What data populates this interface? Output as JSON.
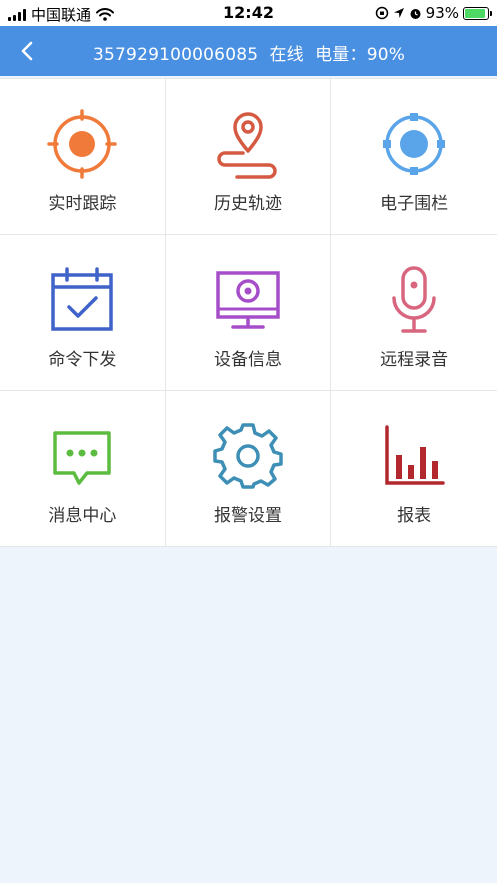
{
  "status_bar": {
    "carrier": "中国联通",
    "time": "12:42",
    "battery_percent": "93%",
    "battery_level": 0.93
  },
  "header": {
    "device_id": "357929100006085",
    "online_status": "在线",
    "battery_text": "电量：90%"
  },
  "menu": [
    {
      "label": "实时跟踪",
      "icon": "crosshair-target-icon",
      "color": "#f07a3a"
    },
    {
      "label": "历史轨迹",
      "icon": "map-pin-route-icon",
      "color": "#d45a42"
    },
    {
      "label": "电子围栏",
      "icon": "geofence-icon",
      "color": "#5aa4ea"
    },
    {
      "label": "命令下发",
      "icon": "calendar-check-icon",
      "color": "#3f63c9"
    },
    {
      "label": "设备信息",
      "icon": "monitor-icon",
      "color": "#a64ec9"
    },
    {
      "label": "远程录音",
      "icon": "microphone-icon",
      "color": "#d9667f"
    },
    {
      "label": "消息中心",
      "icon": "chat-bubble-icon",
      "color": "#5cbc3f"
    },
    {
      "label": "报警设置",
      "icon": "gear-icon",
      "color": "#3e8fb5"
    },
    {
      "label": "报表",
      "icon": "bar-chart-icon",
      "color": "#b3282d"
    }
  ]
}
